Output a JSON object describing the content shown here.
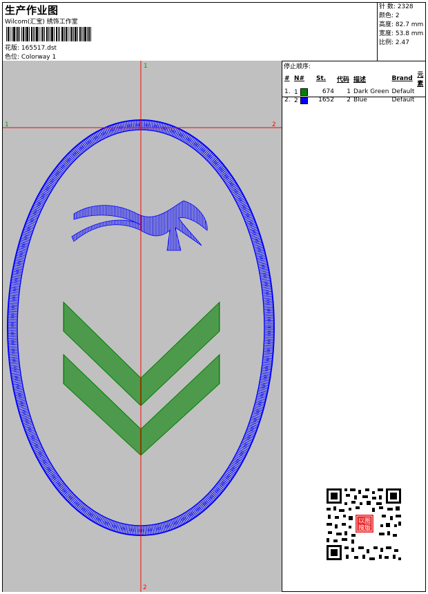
{
  "header": {
    "title": "生产作业图",
    "subtitle": "Wilcom(汇宝) 绣饰工作室",
    "design_label": "花版:",
    "design_value": "165517.dst",
    "colorway_label": "色位:",
    "colorway_value": "Colorway 1"
  },
  "stats": {
    "stitches": "针 数: 2328",
    "colors": "颜色: 2",
    "height": "高度: 82.7 mm",
    "width": "宽度: 53.8 mm",
    "ratio": "比例: 2.47"
  },
  "canvas": {
    "markers": {
      "top": "1",
      "left": "1",
      "right": "2",
      "bottom": "2"
    }
  },
  "stop_sequence": {
    "title": "停止顺序:",
    "headers": [
      "#",
      "N#",
      "St.",
      "代码",
      "描述",
      "Brand",
      "元素"
    ],
    "rows": [
      {
        "idx": "1.",
        "n": "1",
        "color": "#008000",
        "st": "674",
        "code": "1",
        "desc": "Dark Green",
        "brand": "Default"
      },
      {
        "idx": "2.",
        "n": "2",
        "color": "#0000ff",
        "st": "1652",
        "code": "2",
        "desc": "Blue",
        "brand": "Default"
      }
    ]
  },
  "qr": {
    "stamp_text": "以图 搜版"
  }
}
